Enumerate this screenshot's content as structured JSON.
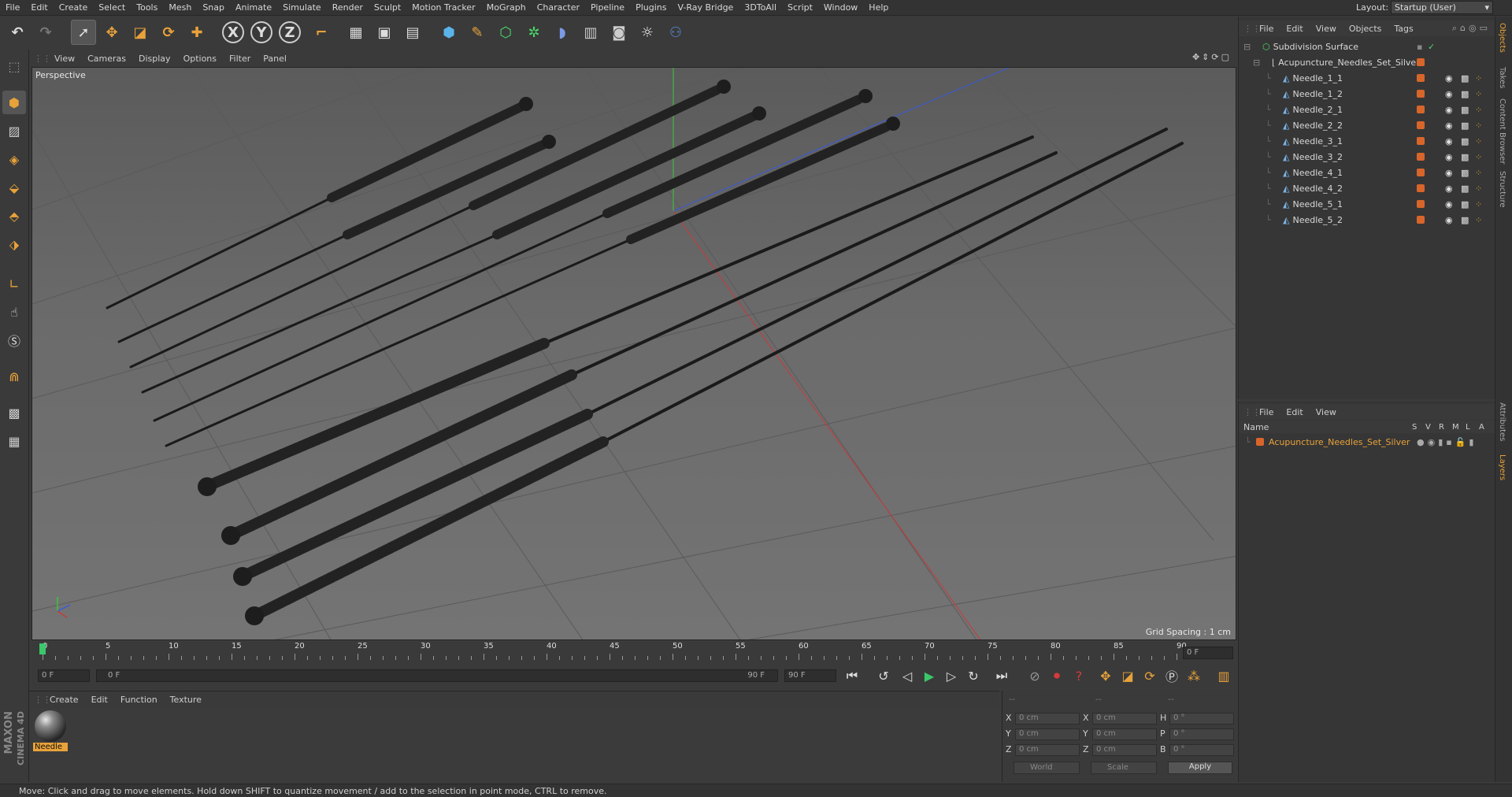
{
  "menu": [
    "File",
    "Edit",
    "Create",
    "Select",
    "Tools",
    "Mesh",
    "Snap",
    "Animate",
    "Simulate",
    "Render",
    "Sculpt",
    "Motion Tracker",
    "MoGraph",
    "Character",
    "Pipeline",
    "Plugins",
    "V-Ray Bridge",
    "3DToAll",
    "Script",
    "Window",
    "Help"
  ],
  "layout": {
    "label": "Layout:",
    "value": "Startup (User)"
  },
  "toolbar": {
    "x": "X",
    "y": "Y",
    "z": "Z"
  },
  "viewport": {
    "menu": [
      "View",
      "Cameras",
      "Display",
      "Options",
      "Filter",
      "Panel"
    ],
    "label": "Perspective",
    "grid": "Grid Spacing : 1 cm"
  },
  "timeline": {
    "ticks": [
      "0",
      "5",
      "10",
      "15",
      "20",
      "25",
      "30",
      "35",
      "40",
      "45",
      "50",
      "55",
      "60",
      "65",
      "70",
      "75",
      "80",
      "85",
      "90"
    ],
    "current": "0 F",
    "start": "0 F",
    "range_start": "0 F",
    "range_end": "90 F",
    "end": "90 F"
  },
  "material": {
    "menu": [
      "Create",
      "Edit",
      "Function",
      "Texture"
    ],
    "name": "Needle"
  },
  "coords": {
    "header": [
      "--",
      "--",
      "--"
    ],
    "x": "0 cm",
    "y": "0 cm",
    "z": "0 cm",
    "sx": "0 cm",
    "sy": "0 cm",
    "sz": "0 cm",
    "h": "0 °",
    "p": "0 °",
    "b": "0 °",
    "world": "World",
    "scale": "Scale",
    "apply": "Apply"
  },
  "objects": {
    "menu": [
      "File",
      "Edit",
      "View",
      "Objects",
      "Tags"
    ],
    "root": "Subdivision Surface",
    "group": "Acupuncture_Needles_Set_Silver",
    "items": [
      "Needle_1_1",
      "Needle_1_2",
      "Needle_2_1",
      "Needle_2_2",
      "Needle_3_1",
      "Needle_3_2",
      "Needle_4_1",
      "Needle_4_2",
      "Needle_5_1",
      "Needle_5_2"
    ]
  },
  "layers": {
    "menu": [
      "File",
      "Edit",
      "View"
    ],
    "header": {
      "name": "Name",
      "cols": [
        "S",
        "V",
        "R",
        "M",
        "L",
        "A"
      ]
    },
    "item": "Acupuncture_Needles_Set_Silver"
  },
  "sidetabs": [
    "Objects",
    "Takes",
    "Content Browser",
    "Structure",
    "Attributes",
    "Layers"
  ],
  "brand": {
    "line1": "MAXON",
    "line2": "CINEMA 4D"
  },
  "status": "Move: Click and drag to move elements. Hold down SHIFT to quantize movement / add to the selection in point mode, CTRL to remove.",
  "colors": {
    "accent": "#d8652a",
    "x_axis": "#c83a3a",
    "y_axis": "#3ac83a",
    "z_axis": "#3a5ad8"
  }
}
